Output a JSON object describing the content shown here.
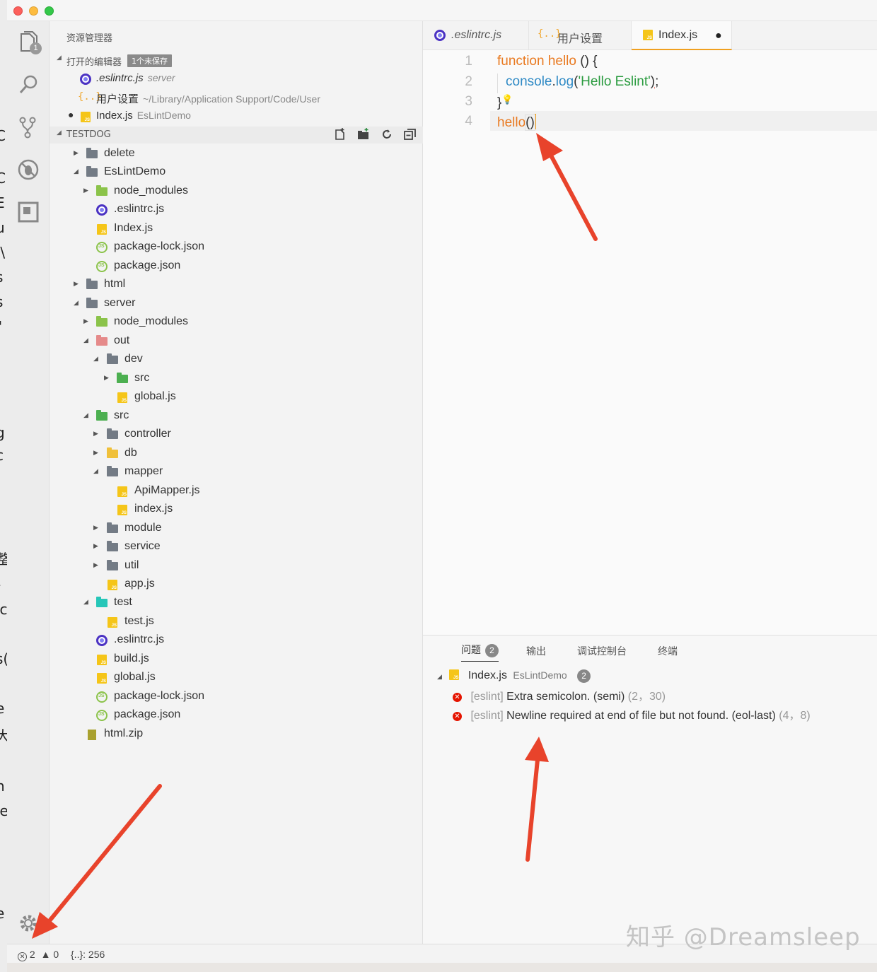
{
  "sidebar": {
    "title": "资源管理器",
    "open_editors": {
      "label": "打开的编辑器",
      "unsaved": "1个未保存",
      "items": [
        {
          "name": ".eslintrc.js",
          "desc": "server"
        },
        {
          "name": "用户设置",
          "desc": "~/Library/Application Support/Code/User"
        },
        {
          "name": "Index.js",
          "desc": "EsLintDemo"
        }
      ]
    },
    "project": {
      "label": "TESTDOG",
      "tree": [
        "delete",
        "EsLintDemo",
        "node_modules",
        ".eslintrc.js",
        "Index.js",
        "package-lock.json",
        "package.json",
        "html",
        "server",
        "node_modules",
        "out",
        "dev",
        "src",
        "global.js",
        "src",
        "controller",
        "db",
        "mapper",
        "ApiMapper.js",
        "index.js",
        "module",
        "service",
        "util",
        "app.js",
        "test",
        "test.js",
        ".eslintrc.js",
        "build.js",
        "global.js",
        "package-lock.json",
        "package.json",
        "html.zip"
      ]
    }
  },
  "activity": {
    "explorer_badge": "1"
  },
  "editor": {
    "tabs": [
      {
        "label": ".eslintrc.js"
      },
      {
        "label": "用户设置"
      },
      {
        "label": "Index.js",
        "dirty": "●"
      }
    ],
    "line_numbers": [
      "1",
      "2",
      "3",
      "4"
    ],
    "code": {
      "l1_kw": "function",
      "l1_fn": " hello",
      "l1_rest": " () {",
      "l2_obj": "console",
      "l2_dot": ".",
      "l2_fn": "log",
      "l2_p1": "(",
      "l2_str": "'Hello Eslint'",
      "l2_p2": ");",
      "l3": "}",
      "l4_fn": "hello",
      "l4_paren": "()"
    }
  },
  "panel": {
    "tabs": [
      {
        "label": "问题",
        "badge": "2"
      },
      {
        "label": "输出"
      },
      {
        "label": "调试控制台"
      },
      {
        "label": "终端"
      }
    ],
    "file": {
      "name": "Index.js",
      "desc": "EsLintDemo",
      "count": "2"
    },
    "problems": [
      {
        "source": "[eslint]",
        "message": "Extra semicolon. (semi)",
        "loc": "(2，30)"
      },
      {
        "source": "[eslint]",
        "message": "Newline required at end of file but not found. (eol-last)",
        "loc": "(4，8)"
      }
    ]
  },
  "status": {
    "errors": "2",
    "warnings": "0",
    "selection": "{..}: 256"
  },
  "watermark": "知乎 @Dreamsleep",
  "colors": {
    "accent": "#f0a020",
    "error": "#e51400",
    "arrow": "#e8432b"
  }
}
